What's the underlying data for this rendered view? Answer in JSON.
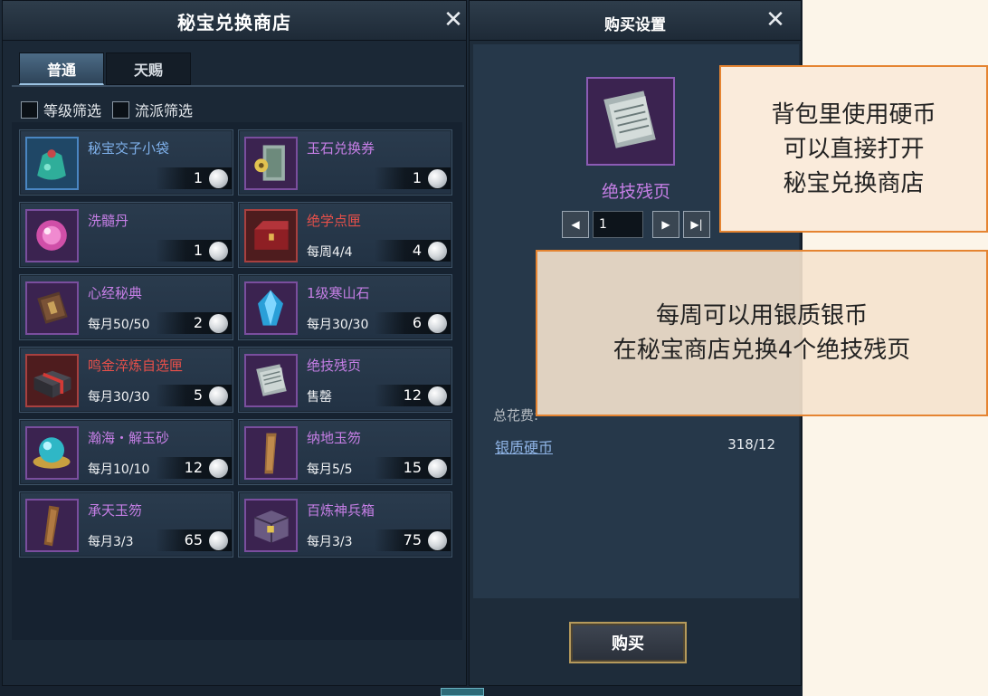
{
  "shop": {
    "title": "秘宝兑换商店",
    "close_label": "✕",
    "tabs": [
      "普通",
      "天赐"
    ],
    "filters": [
      "等级筛选",
      "流派筛选"
    ],
    "items": [
      {
        "name": "秘宝交子小袋",
        "limit": "",
        "price": "1",
        "icon": "jade-pouch-icon",
        "rarity": "blue"
      },
      {
        "name": "玉石兑换券",
        "limit": "",
        "price": "1",
        "icon": "jade-coupon-scroll-icon",
        "rarity": "purple"
      },
      {
        "name": "洗髓丹",
        "limit": "",
        "price": "1",
        "icon": "pill-orb-icon",
        "rarity": "purple"
      },
      {
        "name": "绝学点匣",
        "limit": "每周4/4",
        "price": "4",
        "icon": "treasure-chest-icon",
        "rarity": "red"
      },
      {
        "name": "心经秘典",
        "limit": "每月50/50",
        "price": "2",
        "icon": "scripture-book-icon",
        "rarity": "purple"
      },
      {
        "name": "1级寒山石",
        "limit": "每月30/30",
        "price": "6",
        "icon": "blue-gem-icon",
        "rarity": "purple"
      },
      {
        "name": "鸣金淬炼自选匣",
        "limit": "每月30/30",
        "price": "5",
        "icon": "gift-box-icon",
        "rarity": "red"
      },
      {
        "name": "绝技残页",
        "limit": "售罄",
        "price": "12",
        "icon": "torn-pages-icon",
        "rarity": "purple"
      },
      {
        "name": "瀚海・解玉砂",
        "limit": "每月10/10",
        "price": "12",
        "icon": "jade-sand-orb-icon",
        "rarity": "purple"
      },
      {
        "name": "纳地玉笏",
        "limit": "每月5/5",
        "price": "15",
        "icon": "jade-tablet-icon",
        "rarity": "purple"
      },
      {
        "name": "承天玉笏",
        "limit": "每月3/3",
        "price": "65",
        "icon": "jade-tablet-icon",
        "rarity": "purple"
      },
      {
        "name": "百炼神兵箱",
        "limit": "每月3/3",
        "price": "75",
        "icon": "weapon-box-icon",
        "rarity": "purple"
      }
    ]
  },
  "buy": {
    "title": "购买设置",
    "close_label": "✕",
    "item_name": "绝技残页",
    "item_icon": "torn-pages-icon",
    "quantity": "1",
    "decrease_label": "◀",
    "increase_label": "▶",
    "max_label": "▶|",
    "total_label": "总花费:",
    "currency_name": "银质硬币",
    "currency_count": "318/12",
    "buy_label": "购买"
  },
  "notes": {
    "note1": [
      "背包里使用硬币",
      "可以直接打开",
      "秘宝兑换商店"
    ],
    "note2": [
      "每周可以用银质银币",
      "在秘宝商店兑换4个绝技残页"
    ]
  },
  "colors": {
    "blue_name": "#7eb0ea",
    "purple_name": "#c67fe6",
    "red_name": "#e8504a",
    "note_border": "#e58431"
  }
}
